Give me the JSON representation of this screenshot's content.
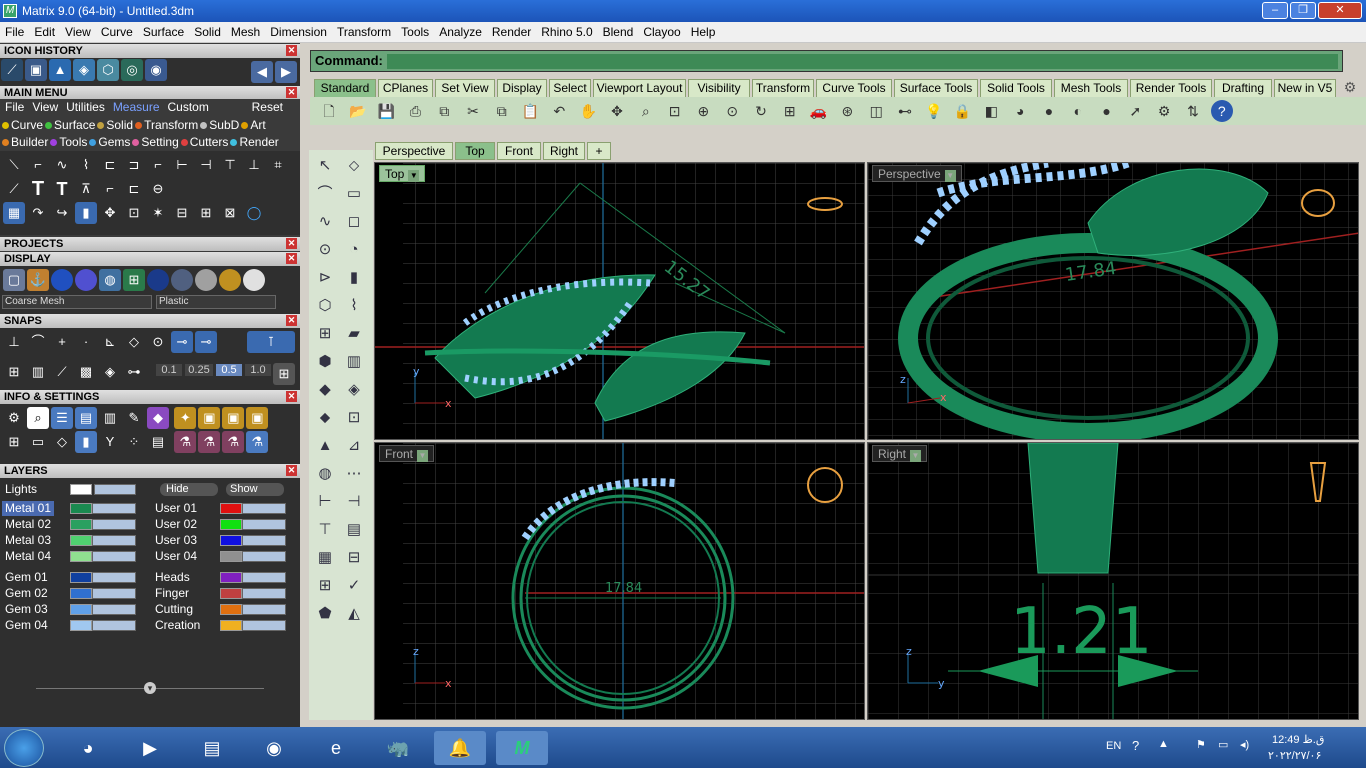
{
  "window": {
    "title": "Matrix 9.0 (64-bit) - Untitled.3dm",
    "app_icon": "matrix-logo-icon",
    "controls": [
      "minimize",
      "maximize",
      "close"
    ]
  },
  "menubar": [
    "File",
    "Edit",
    "View",
    "Curve",
    "Surface",
    "Solid",
    "Mesh",
    "Dimension",
    "Transform",
    "Tools",
    "Analyze",
    "Render",
    "Rhino 5.0",
    "Blend",
    "Clayoo",
    "Help"
  ],
  "left_panel": {
    "icon_history": "ICON HISTORY",
    "main_menu": "MAIN MENU",
    "submenu": [
      "File",
      "View",
      "Utilities",
      "Measure",
      "Custom",
      "Reset"
    ],
    "submenu_active": "Measure",
    "categories_row1": [
      "Curve",
      "Surface",
      "Solid",
      "Transform",
      "SubD",
      "Art"
    ],
    "categories_row2": [
      "Builder",
      "Tools",
      "Gems",
      "Setting",
      "Cutters",
      "Render"
    ],
    "category_colors1": [
      "#e0c000",
      "#40c040",
      "#c0a040",
      "#e06020",
      "#c0c0c0",
      "#e0a000"
    ],
    "category_colors2": [
      "#e08020",
      "#a040e0",
      "#40a0e0",
      "#e060a0",
      "#e04040",
      "#40c0e0"
    ],
    "projects": "PROJECTS",
    "display": "DISPLAY",
    "display_dropdown1": "Coarse Mesh",
    "display_dropdown2": "Plastic",
    "snaps": "SNAPS",
    "snap_values": [
      "0.1",
      "0.25",
      "0.5",
      "1.0"
    ],
    "snap_value_selected": "0.5",
    "info_settings": "INFO & SETTINGS",
    "layers_header": "LAYERS",
    "lights_label": "Lights",
    "hide_label": "Hide",
    "show_label": "Show",
    "layers_left": [
      {
        "name": "Metal 01",
        "color": "#1a8a50"
      },
      {
        "name": "Metal 02",
        "color": "#2aa060"
      },
      {
        "name": "Metal 03",
        "color": "#50d070"
      },
      {
        "name": "Metal 04",
        "color": "#90e090"
      },
      {
        "name": "Gem 01",
        "color": "#1040a0"
      },
      {
        "name": "Gem 02",
        "color": "#3070d0"
      },
      {
        "name": "Gem 03",
        "color": "#60a0e8"
      },
      {
        "name": "Gem 04",
        "color": "#a0c8f0"
      }
    ],
    "layers_right": [
      {
        "name": "User 01",
        "color": "#e01010"
      },
      {
        "name": "User 02",
        "color": "#10e010"
      },
      {
        "name": "User 03",
        "color": "#1010e0"
      },
      {
        "name": "User 04",
        "color": "#909090"
      },
      {
        "name": "Heads",
        "color": "#8020c0"
      },
      {
        "name": "Finger",
        "color": "#c04040"
      },
      {
        "name": "Cutting",
        "color": "#e07010"
      },
      {
        "name": "Creation",
        "color": "#f0b020"
      }
    ],
    "selected_layer": "Metal 01"
  },
  "command": {
    "label": "Command:",
    "value": ""
  },
  "toolbar_tabs": [
    "Standard",
    "CPlanes",
    "Set View",
    "Display",
    "Select",
    "Viewport Layout",
    "Visibility",
    "Transform",
    "Curve Tools",
    "Surface Tools",
    "Solid Tools",
    "Mesh Tools",
    "Render Tools",
    "Drafting",
    "New in V5"
  ],
  "toolbar_tab_active": "Standard",
  "toolbar_icons": [
    "new-file-icon",
    "open-folder-icon",
    "save-icon",
    "print-icon",
    "import-icon",
    "cut-icon",
    "copy-icon",
    "paste-icon",
    "undo-icon",
    "pan-hand-icon",
    "move-view-icon",
    "zoom-icon",
    "zoom-window-icon",
    "zoom-extents-icon",
    "zoom-selected-icon",
    "rotate-view-icon",
    "four-view-icon",
    "car-icon",
    "set-view-icon",
    "grid-icon",
    "selection-filter-icon",
    "light-bulb-icon",
    "lock-icon",
    "layer-icon",
    "color-wheel-icon",
    "material-sphere-icon",
    "render-sphere-icon",
    "shaded-sphere-icon",
    "cursor-star-icon",
    "settings-gear-icon",
    "flow-icon",
    "help-icon"
  ],
  "viewport_tabs": [
    "Perspective",
    "Top",
    "Front",
    "Right"
  ],
  "viewport_tab_active": "Top",
  "viewports": {
    "top": {
      "label": "Top",
      "dimension": "15.27"
    },
    "perspective": {
      "label": "Perspective",
      "dimension": "17.84"
    },
    "front": {
      "label": "Front",
      "dimension": "17.84"
    },
    "right": {
      "label": "Right",
      "dimension": "1.21"
    }
  },
  "axes": {
    "x": "x",
    "y": "y",
    "z": "z"
  },
  "taskbar": {
    "apps": [
      "chrome-icon",
      "media-player-icon",
      "folder-icon",
      "firefox-icon",
      "ie-icon",
      "rhino-icon",
      "notification-bell-icon",
      "matrix-app-icon"
    ],
    "lang": "EN",
    "time": "ق.ظ 12:49",
    "date": "۲۰۲۲/۲۷/۰۶"
  }
}
